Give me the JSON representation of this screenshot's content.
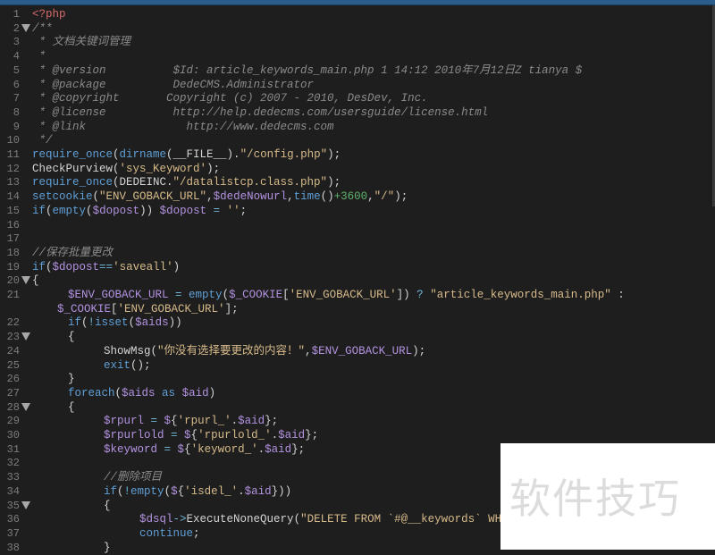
{
  "editor": {
    "language": "php",
    "lines": [
      {
        "n": "1",
        "fold": false,
        "indent": 0,
        "tokens": [
          {
            "t": "php",
            "v": "<?php"
          }
        ]
      },
      {
        "n": "2",
        "fold": true,
        "indent": 0,
        "tokens": [
          {
            "t": "cm",
            "v": "/**"
          }
        ]
      },
      {
        "n": "3",
        "fold": false,
        "indent": 0,
        "tokens": [
          {
            "t": "cm",
            "v": " * 文档关键词管理"
          }
        ]
      },
      {
        "n": "4",
        "fold": false,
        "indent": 0,
        "tokens": [
          {
            "t": "cm",
            "v": " *"
          }
        ]
      },
      {
        "n": "5",
        "fold": false,
        "indent": 0,
        "tokens": [
          {
            "t": "cm",
            "v": " * @version          $Id: article_keywords_main.php 1 14:12 2010年7月12日Z tianya $"
          }
        ]
      },
      {
        "n": "6",
        "fold": false,
        "indent": 0,
        "tokens": [
          {
            "t": "cm",
            "v": " * @package          DedeCMS.Administrator"
          }
        ]
      },
      {
        "n": "7",
        "fold": false,
        "indent": 0,
        "tokens": [
          {
            "t": "cm",
            "v": " * @copyright       Copyright (c) 2007 - 2010, DesDev, Inc."
          }
        ]
      },
      {
        "n": "8",
        "fold": false,
        "indent": 0,
        "tokens": [
          {
            "t": "cm",
            "v": " * @license          http://help.dedecms.com/usersguide/license.html"
          }
        ]
      },
      {
        "n": "9",
        "fold": false,
        "indent": 0,
        "tokens": [
          {
            "t": "cm",
            "v": " * @link               http://www.dedecms.com"
          }
        ]
      },
      {
        "n": "10",
        "fold": false,
        "indent": 0,
        "tokens": [
          {
            "t": "cm",
            "v": " */"
          }
        ]
      },
      {
        "n": "11",
        "fold": false,
        "indent": 0,
        "tokens": [
          {
            "t": "fn",
            "v": "require_once"
          },
          {
            "t": "pn",
            "v": "("
          },
          {
            "t": "fn",
            "v": "dirname"
          },
          {
            "t": "pn",
            "v": "(__FILE__)."
          },
          {
            "t": "str",
            "v": "\"/config.php\""
          },
          {
            "t": "pn",
            "v": ");"
          }
        ]
      },
      {
        "n": "12",
        "fold": false,
        "indent": 0,
        "tokens": [
          {
            "t": "id",
            "v": "CheckPurview"
          },
          {
            "t": "pn",
            "v": "("
          },
          {
            "t": "str",
            "v": "'sys_Keyword'"
          },
          {
            "t": "pn",
            "v": ");"
          }
        ]
      },
      {
        "n": "13",
        "fold": false,
        "indent": 0,
        "tokens": [
          {
            "t": "fn",
            "v": "require_once"
          },
          {
            "t": "pn",
            "v": "(DEDEINC."
          },
          {
            "t": "str",
            "v": "\"/datalistcp.class.php\""
          },
          {
            "t": "pn",
            "v": ");"
          }
        ]
      },
      {
        "n": "14",
        "fold": false,
        "indent": 0,
        "tokens": [
          {
            "t": "fn",
            "v": "setcookie"
          },
          {
            "t": "pn",
            "v": "("
          },
          {
            "t": "str",
            "v": "\"ENV_GOBACK_URL\""
          },
          {
            "t": "pn",
            "v": ","
          },
          {
            "t": "var",
            "v": "$dedeNowurl"
          },
          {
            "t": "pn",
            "v": ","
          },
          {
            "t": "fn",
            "v": "time"
          },
          {
            "t": "pn",
            "v": "()"
          },
          {
            "t": "num",
            "v": "+3600"
          },
          {
            "t": "pn",
            "v": ","
          },
          {
            "t": "str",
            "v": "\"/\""
          },
          {
            "t": "pn",
            "v": ");"
          }
        ]
      },
      {
        "n": "15",
        "fold": false,
        "indent": 0,
        "tokens": [
          {
            "t": "kw",
            "v": "if"
          },
          {
            "t": "pn",
            "v": "("
          },
          {
            "t": "fn",
            "v": "empty"
          },
          {
            "t": "pn",
            "v": "("
          },
          {
            "t": "var",
            "v": "$dopost"
          },
          {
            "t": "pn",
            "v": ")) "
          },
          {
            "t": "var",
            "v": "$dopost"
          },
          {
            "t": "op",
            "v": " = "
          },
          {
            "t": "str",
            "v": "''"
          },
          {
            "t": "pn",
            "v": ";"
          }
        ]
      },
      {
        "n": "16",
        "fold": false,
        "indent": 0,
        "tokens": []
      },
      {
        "n": "17",
        "fold": false,
        "indent": 0,
        "tokens": []
      },
      {
        "n": "18",
        "fold": false,
        "indent": 0,
        "tokens": [
          {
            "t": "cm",
            "v": "//保存批量更改"
          }
        ]
      },
      {
        "n": "19",
        "fold": false,
        "indent": 0,
        "tokens": [
          {
            "t": "kw",
            "v": "if"
          },
          {
            "t": "pn",
            "v": "("
          },
          {
            "t": "var",
            "v": "$dopost"
          },
          {
            "t": "op",
            "v": "=="
          },
          {
            "t": "str",
            "v": "'saveall'"
          },
          {
            "t": "pn",
            "v": ")"
          }
        ]
      },
      {
        "n": "20",
        "fold": true,
        "indent": 0,
        "tokens": [
          {
            "t": "pn",
            "v": "{"
          }
        ]
      },
      {
        "n": "21",
        "fold": false,
        "indent": 1,
        "tokens": [
          {
            "t": "var",
            "v": "$ENV_GOBACK_URL"
          },
          {
            "t": "op",
            "v": " = "
          },
          {
            "t": "fn",
            "v": "empty"
          },
          {
            "t": "pn",
            "v": "("
          },
          {
            "t": "var",
            "v": "$_COOKIE"
          },
          {
            "t": "pn",
            "v": "["
          },
          {
            "t": "str",
            "v": "'ENV_GOBACK_URL'"
          },
          {
            "t": "pn",
            "v": "]) "
          },
          {
            "t": "op",
            "v": "?"
          },
          {
            "t": "pn",
            "v": " "
          },
          {
            "t": "str",
            "v": "\"article_keywords_main.php\""
          },
          {
            "t": "pn",
            "v": " :"
          }
        ]
      },
      {
        "n": "",
        "fold": false,
        "indent": 0,
        "wrapped": true,
        "tokens": [
          {
            "t": "var",
            "v": "$_COOKIE"
          },
          {
            "t": "pn",
            "v": "["
          },
          {
            "t": "str",
            "v": "'ENV_GOBACK_URL'"
          },
          {
            "t": "pn",
            "v": "];"
          }
        ]
      },
      {
        "n": "22",
        "fold": false,
        "indent": 1,
        "tokens": [
          {
            "t": "kw",
            "v": "if"
          },
          {
            "t": "pn",
            "v": "("
          },
          {
            "t": "op",
            "v": "!"
          },
          {
            "t": "fn",
            "v": "isset"
          },
          {
            "t": "pn",
            "v": "("
          },
          {
            "t": "var",
            "v": "$aids"
          },
          {
            "t": "pn",
            "v": "))"
          }
        ]
      },
      {
        "n": "23",
        "fold": true,
        "indent": 1,
        "tokens": [
          {
            "t": "pn",
            "v": "{"
          }
        ]
      },
      {
        "n": "24",
        "fold": false,
        "indent": 2,
        "tokens": [
          {
            "t": "id",
            "v": "ShowMsg"
          },
          {
            "t": "pn",
            "v": "("
          },
          {
            "t": "str",
            "v": "\"你没有选择要更改的内容！\""
          },
          {
            "t": "pn",
            "v": ","
          },
          {
            "t": "var",
            "v": "$ENV_GOBACK_URL"
          },
          {
            "t": "pn",
            "v": ");"
          }
        ]
      },
      {
        "n": "25",
        "fold": false,
        "indent": 2,
        "tokens": [
          {
            "t": "fn",
            "v": "exit"
          },
          {
            "t": "pn",
            "v": "();"
          }
        ]
      },
      {
        "n": "26",
        "fold": false,
        "indent": 1,
        "tokens": [
          {
            "t": "pn",
            "v": "}"
          }
        ]
      },
      {
        "n": "27",
        "fold": false,
        "indent": 1,
        "tokens": [
          {
            "t": "kw",
            "v": "foreach"
          },
          {
            "t": "pn",
            "v": "("
          },
          {
            "t": "var",
            "v": "$aids"
          },
          {
            "t": "kw",
            "v": " as "
          },
          {
            "t": "var",
            "v": "$aid"
          },
          {
            "t": "pn",
            "v": ")"
          }
        ]
      },
      {
        "n": "28",
        "fold": true,
        "indent": 1,
        "tokens": [
          {
            "t": "pn",
            "v": "{"
          }
        ]
      },
      {
        "n": "29",
        "fold": false,
        "indent": 2,
        "tokens": [
          {
            "t": "var",
            "v": "$rpurl"
          },
          {
            "t": "op",
            "v": " = "
          },
          {
            "t": "var",
            "v": "$"
          },
          {
            "t": "pn",
            "v": "{"
          },
          {
            "t": "str",
            "v": "'rpurl_'"
          },
          {
            "t": "pn",
            "v": "."
          },
          {
            "t": "var",
            "v": "$aid"
          },
          {
            "t": "pn",
            "v": "};"
          }
        ]
      },
      {
        "n": "30",
        "fold": false,
        "indent": 2,
        "tokens": [
          {
            "t": "var",
            "v": "$rpurlold"
          },
          {
            "t": "op",
            "v": " = "
          },
          {
            "t": "var",
            "v": "$"
          },
          {
            "t": "pn",
            "v": "{"
          },
          {
            "t": "str",
            "v": "'rpurlold_'"
          },
          {
            "t": "pn",
            "v": "."
          },
          {
            "t": "var",
            "v": "$aid"
          },
          {
            "t": "pn",
            "v": "};"
          }
        ]
      },
      {
        "n": "31",
        "fold": false,
        "indent": 2,
        "tokens": [
          {
            "t": "var",
            "v": "$keyword"
          },
          {
            "t": "op",
            "v": " = "
          },
          {
            "t": "var",
            "v": "$"
          },
          {
            "t": "pn",
            "v": "{"
          },
          {
            "t": "str",
            "v": "'keyword_'"
          },
          {
            "t": "pn",
            "v": "."
          },
          {
            "t": "var",
            "v": "$aid"
          },
          {
            "t": "pn",
            "v": "};"
          }
        ]
      },
      {
        "n": "32",
        "fold": false,
        "indent": 0,
        "tokens": []
      },
      {
        "n": "33",
        "fold": false,
        "indent": 2,
        "tokens": [
          {
            "t": "cm",
            "v": "//删除项目"
          }
        ]
      },
      {
        "n": "34",
        "fold": false,
        "indent": 2,
        "tokens": [
          {
            "t": "kw",
            "v": "if"
          },
          {
            "t": "pn",
            "v": "("
          },
          {
            "t": "op",
            "v": "!"
          },
          {
            "t": "fn",
            "v": "empty"
          },
          {
            "t": "pn",
            "v": "("
          },
          {
            "t": "var",
            "v": "$"
          },
          {
            "t": "pn",
            "v": "{"
          },
          {
            "t": "str",
            "v": "'isdel_'"
          },
          {
            "t": "pn",
            "v": "."
          },
          {
            "t": "var",
            "v": "$aid"
          },
          {
            "t": "pn",
            "v": "}))"
          }
        ]
      },
      {
        "n": "35",
        "fold": true,
        "indent": 2,
        "tokens": [
          {
            "t": "pn",
            "v": "{"
          }
        ]
      },
      {
        "n": "36",
        "fold": false,
        "indent": 3,
        "tokens": [
          {
            "t": "var",
            "v": "$dsql"
          },
          {
            "t": "op",
            "v": "->"
          },
          {
            "t": "id",
            "v": "ExecuteNoneQuery"
          },
          {
            "t": "pn",
            "v": "("
          },
          {
            "t": "str",
            "v": "\"DELETE FROM `#@__keywords` WHERE"
          }
        ]
      },
      {
        "n": "37",
        "fold": false,
        "indent": 3,
        "tokens": [
          {
            "t": "kw",
            "v": "continue"
          },
          {
            "t": "pn",
            "v": ";"
          }
        ]
      },
      {
        "n": "38",
        "fold": false,
        "indent": 2,
        "tokens": [
          {
            "t": "pn",
            "v": "}"
          }
        ]
      }
    ]
  },
  "watermark": {
    "text": "软件技巧"
  }
}
